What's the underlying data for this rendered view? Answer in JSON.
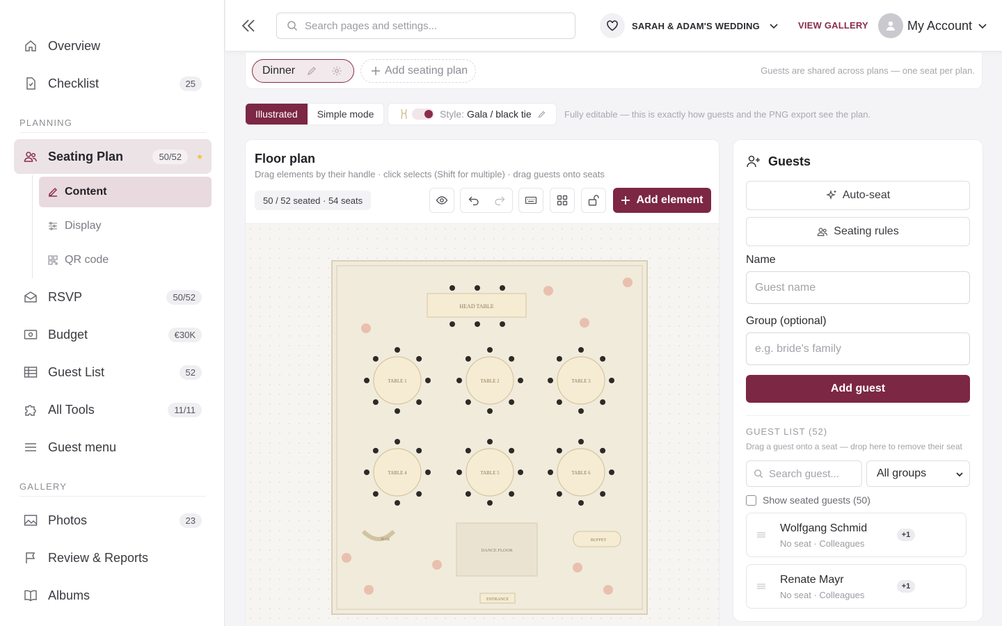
{
  "sidebar": {
    "items_top": [
      {
        "label": "Overview",
        "icon": "home-icon"
      },
      {
        "label": "Checklist",
        "icon": "checklist-icon",
        "badge": "25"
      }
    ],
    "planning_label": "PLANNING",
    "seating": {
      "label": "Seating Plan",
      "badge": "50/52",
      "icon": "users-icon"
    },
    "seating_sub": [
      {
        "label": "Content",
        "icon": "edit-icon"
      },
      {
        "label": "Display",
        "icon": "sliders-icon"
      },
      {
        "label": "QR code",
        "icon": "qr-icon"
      }
    ],
    "items_planning": [
      {
        "label": "RSVP",
        "badge": "50/52",
        "icon": "mail-icon"
      },
      {
        "label": "Budget",
        "badge": "€30K",
        "icon": "money-icon"
      },
      {
        "label": "Guest List",
        "badge": "52",
        "icon": "table-icon"
      },
      {
        "label": "All Tools",
        "badge": "11/11",
        "icon": "puzzle-icon"
      },
      {
        "label": "Guest menu",
        "icon": "menu-icon"
      }
    ],
    "gallery_label": "GALLERY",
    "items_gallery": [
      {
        "label": "Photos",
        "badge": "23",
        "icon": "image-icon"
      },
      {
        "label": "Review & Reports",
        "icon": "flag-icon"
      },
      {
        "label": "Albums",
        "icon": "book-icon"
      }
    ]
  },
  "topbar": {
    "search_placeholder": "Search pages and settings...",
    "event_name": "SARAH & ADAM'S WEDDING",
    "view_gallery": "VIEW GALLERY",
    "account_label": "My Account"
  },
  "plans": {
    "active": "Dinner",
    "add_label": "Add seating plan",
    "note": "Guests are shared across plans — one seat per plan."
  },
  "mode": {
    "illustrated": "Illustrated",
    "simple": "Simple mode",
    "style_prefix": "Style:",
    "style_value": "Gala / black tie",
    "note": "Fully editable — this is exactly how guests and the PNG export see the plan."
  },
  "floor": {
    "title": "Floor plan",
    "subtitle": "Drag elements by their handle · click selects (Shift for multiple) · drag guests onto seats",
    "seat_count": "50 / 52 seated · 54 seats",
    "add_element": "Add element",
    "labels": {
      "head": "HEAD TABLE",
      "t1": "TABLE 1",
      "t2": "TABLE 2",
      "t3": "TABLE 3",
      "t4": "TABLE 4",
      "t5": "TABLE 5",
      "t6": "TABLE 6",
      "bar": "BAR",
      "dance": "DANCE FLOOR",
      "buffet": "BUFFET",
      "entrance": "ENTRANCE"
    }
  },
  "guests": {
    "title": "Guests",
    "auto_seat": "Auto-seat",
    "rules": "Seating rules",
    "name_label": "Name",
    "name_placeholder": "Guest name",
    "group_label": "Group (optional)",
    "group_placeholder": "e.g. bride's family",
    "add_button": "Add guest",
    "list_title": "GUEST LIST (52)",
    "list_sub": "Drag a guest onto a seat — drop here to remove their seat",
    "search_placeholder": "Search guest...",
    "group_filter": "All groups",
    "show_seated": "Show seated guests (50)",
    "rows": [
      {
        "name": "Wolfgang Schmid",
        "meta": "No seat · Colleagues",
        "plus": "+1"
      },
      {
        "name": "Renate Mayr",
        "meta": "No seat · Colleagues",
        "plus": "+1"
      }
    ]
  },
  "colors": {
    "accent": "#7c2744",
    "accent_light": "#ece3e7",
    "poster_bg": "#f1ebdc"
  }
}
